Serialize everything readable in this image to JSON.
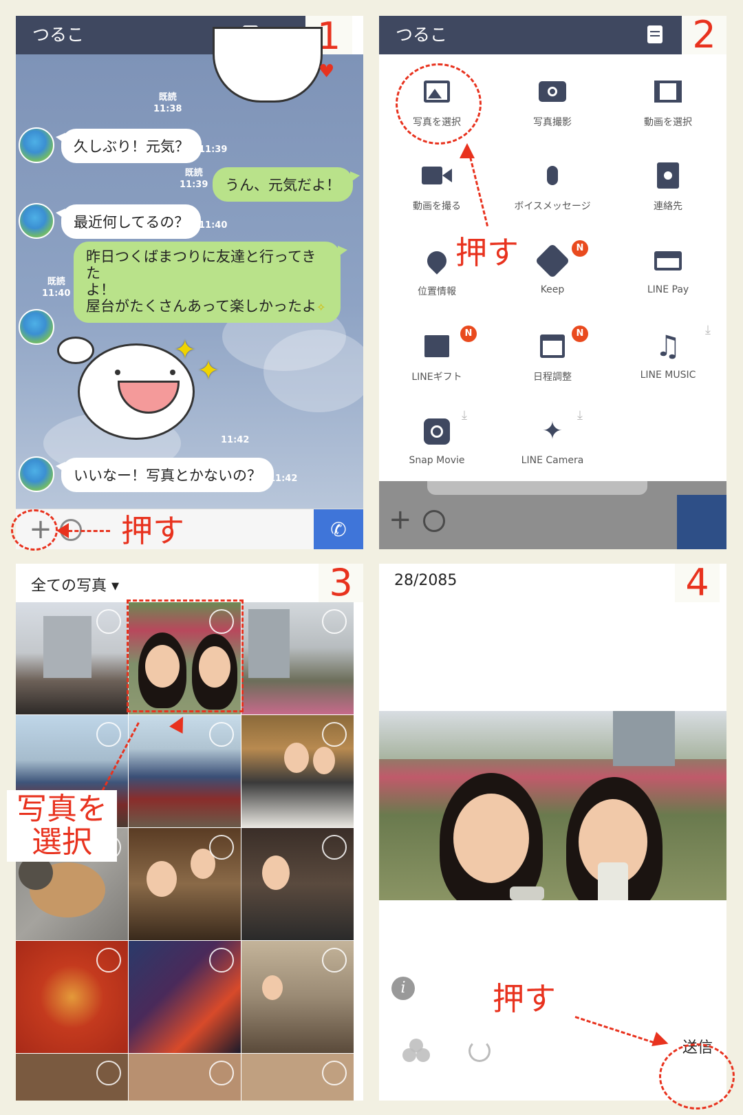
{
  "panel1": {
    "badge": "1",
    "chat_title": "つるこ",
    "messages": {
      "read1": "既読",
      "time1": "11:38",
      "m1": "久しぶり！元気？",
      "t_m1": "11:39",
      "read2": "既読",
      "time2": "11:39",
      "m2": "うん、元気だよ！",
      "m3": "最近何してるの？",
      "t_m3": "11:40",
      "m4_line1": "昨日つくばまつりに友達と行ってきた",
      "m4_line2": "よ！",
      "m4_line3": "屋台がたくさんあって楽しかったよ",
      "read4": "既読",
      "time4": "11:40",
      "t_sticker": "11:42",
      "m5": "いいなー！写真とかないの？",
      "t_m5": "11:42"
    },
    "plus_glyph": "+",
    "call_glyph": "✆",
    "annotation": "押す"
  },
  "panel2": {
    "badge": "2",
    "chat_title": "つるこ",
    "menu": [
      {
        "label": "写真を選択",
        "icon": "image-icon"
      },
      {
        "label": "写真撮影",
        "icon": "camera-icon"
      },
      {
        "label": "動画を選択",
        "icon": "film-icon"
      },
      {
        "label": "動画を撮る",
        "icon": "video-camera-icon"
      },
      {
        "label": "ボイスメッセージ",
        "icon": "microphone-icon"
      },
      {
        "label": "連絡先",
        "icon": "contact-icon"
      },
      {
        "label": "位置情報",
        "icon": "location-pin-icon"
      },
      {
        "label": "Keep",
        "icon": "keep-icon",
        "badge": "N"
      },
      {
        "label": "LINE Pay",
        "icon": "card-icon"
      },
      {
        "label": "LINEギフト",
        "icon": "gift-icon",
        "badge": "N"
      },
      {
        "label": "日程調整",
        "icon": "calendar-check-icon",
        "badge": "N"
      },
      {
        "label": "LINE MUSIC",
        "icon": "music-note-icon"
      },
      {
        "label": "Snap Movie",
        "icon": "snap-movie-icon"
      },
      {
        "label": "LINE Camera",
        "icon": "magic-wand-icon"
      }
    ],
    "glyphs": {
      "image": "▧",
      "camera": "◉",
      "film": "▤",
      "video": "■",
      "mic": "🎤",
      "contact": "▣",
      "pin": "●",
      "keep": "⬇",
      "card": "▭",
      "gift": "▦",
      "calendar": "☑",
      "music": "♫",
      "snap": "◎",
      "wand": "✦",
      "download": "⤓"
    },
    "annotation": "押す"
  },
  "panel3": {
    "badge": "3",
    "album_select": "全ての写真 ▾",
    "annotation_line1": "写真を",
    "annotation_line2": "選択"
  },
  "panel4": {
    "badge": "4",
    "counter": "28/2085",
    "info_glyph": "i",
    "send_label": "送信",
    "annotation": "押す"
  }
}
